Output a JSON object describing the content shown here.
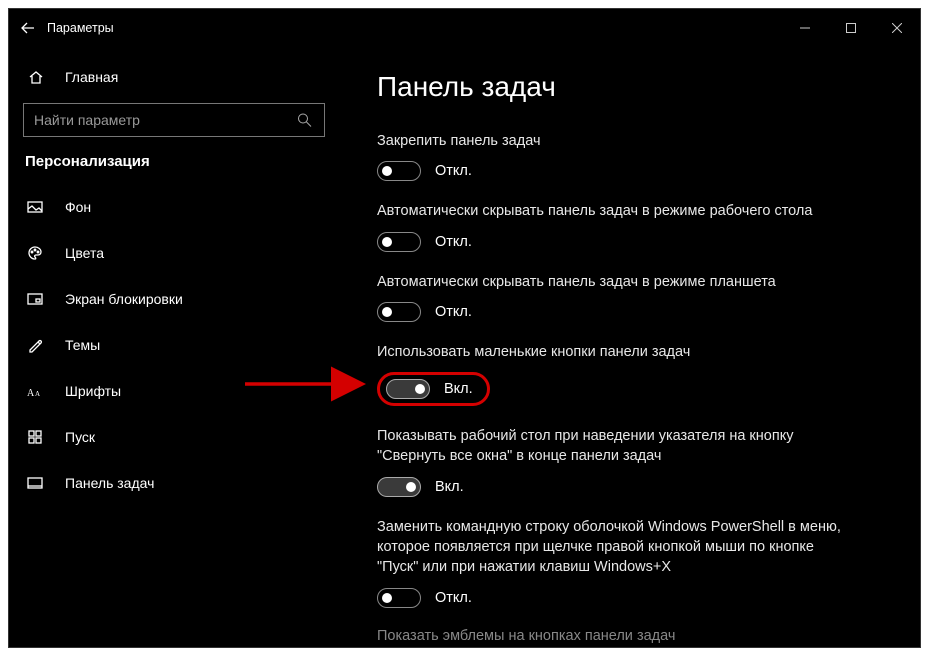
{
  "window": {
    "title": "Параметры"
  },
  "sidebar": {
    "home": "Главная",
    "search_placeholder": "Найти параметр",
    "section": "Персонализация",
    "items": [
      {
        "label": "Фон"
      },
      {
        "label": "Цвета"
      },
      {
        "label": "Экран блокировки"
      },
      {
        "label": "Темы"
      },
      {
        "label": "Шрифты"
      },
      {
        "label": "Пуск"
      },
      {
        "label": "Панель задач"
      }
    ]
  },
  "page": {
    "title": "Панель задач",
    "settings": [
      {
        "label": "Закрепить панель задач",
        "state_text": "Откл.",
        "on": false,
        "hl": false
      },
      {
        "label": "Автоматически скрывать панель задач в режиме рабочего стола",
        "state_text": "Откл.",
        "on": false,
        "hl": false
      },
      {
        "label": "Автоматически скрывать панель задач в режиме планшета",
        "state_text": "Откл.",
        "on": false,
        "hl": false
      },
      {
        "label": "Использовать маленькие кнопки панели задач",
        "state_text": "Вкл.",
        "on": true,
        "hl": true
      },
      {
        "label": "Показывать рабочий стол при наведении указателя на кнопку \"Свернуть все окна\" в конце панели задач",
        "state_text": "Вкл.",
        "on": true,
        "hl": false
      },
      {
        "label": "Заменить командную строку оболочкой Windows PowerShell в меню, которое появляется при щелчке правой кнопкой мыши по кнопке \"Пуск\" или при нажатии клавиш Windows+X",
        "state_text": "Откл.",
        "on": false,
        "hl": false
      }
    ],
    "cutoff_label": "Показать эмблемы на кнопках панели задач"
  },
  "annotation": {
    "highlight_color": "#d40000"
  }
}
